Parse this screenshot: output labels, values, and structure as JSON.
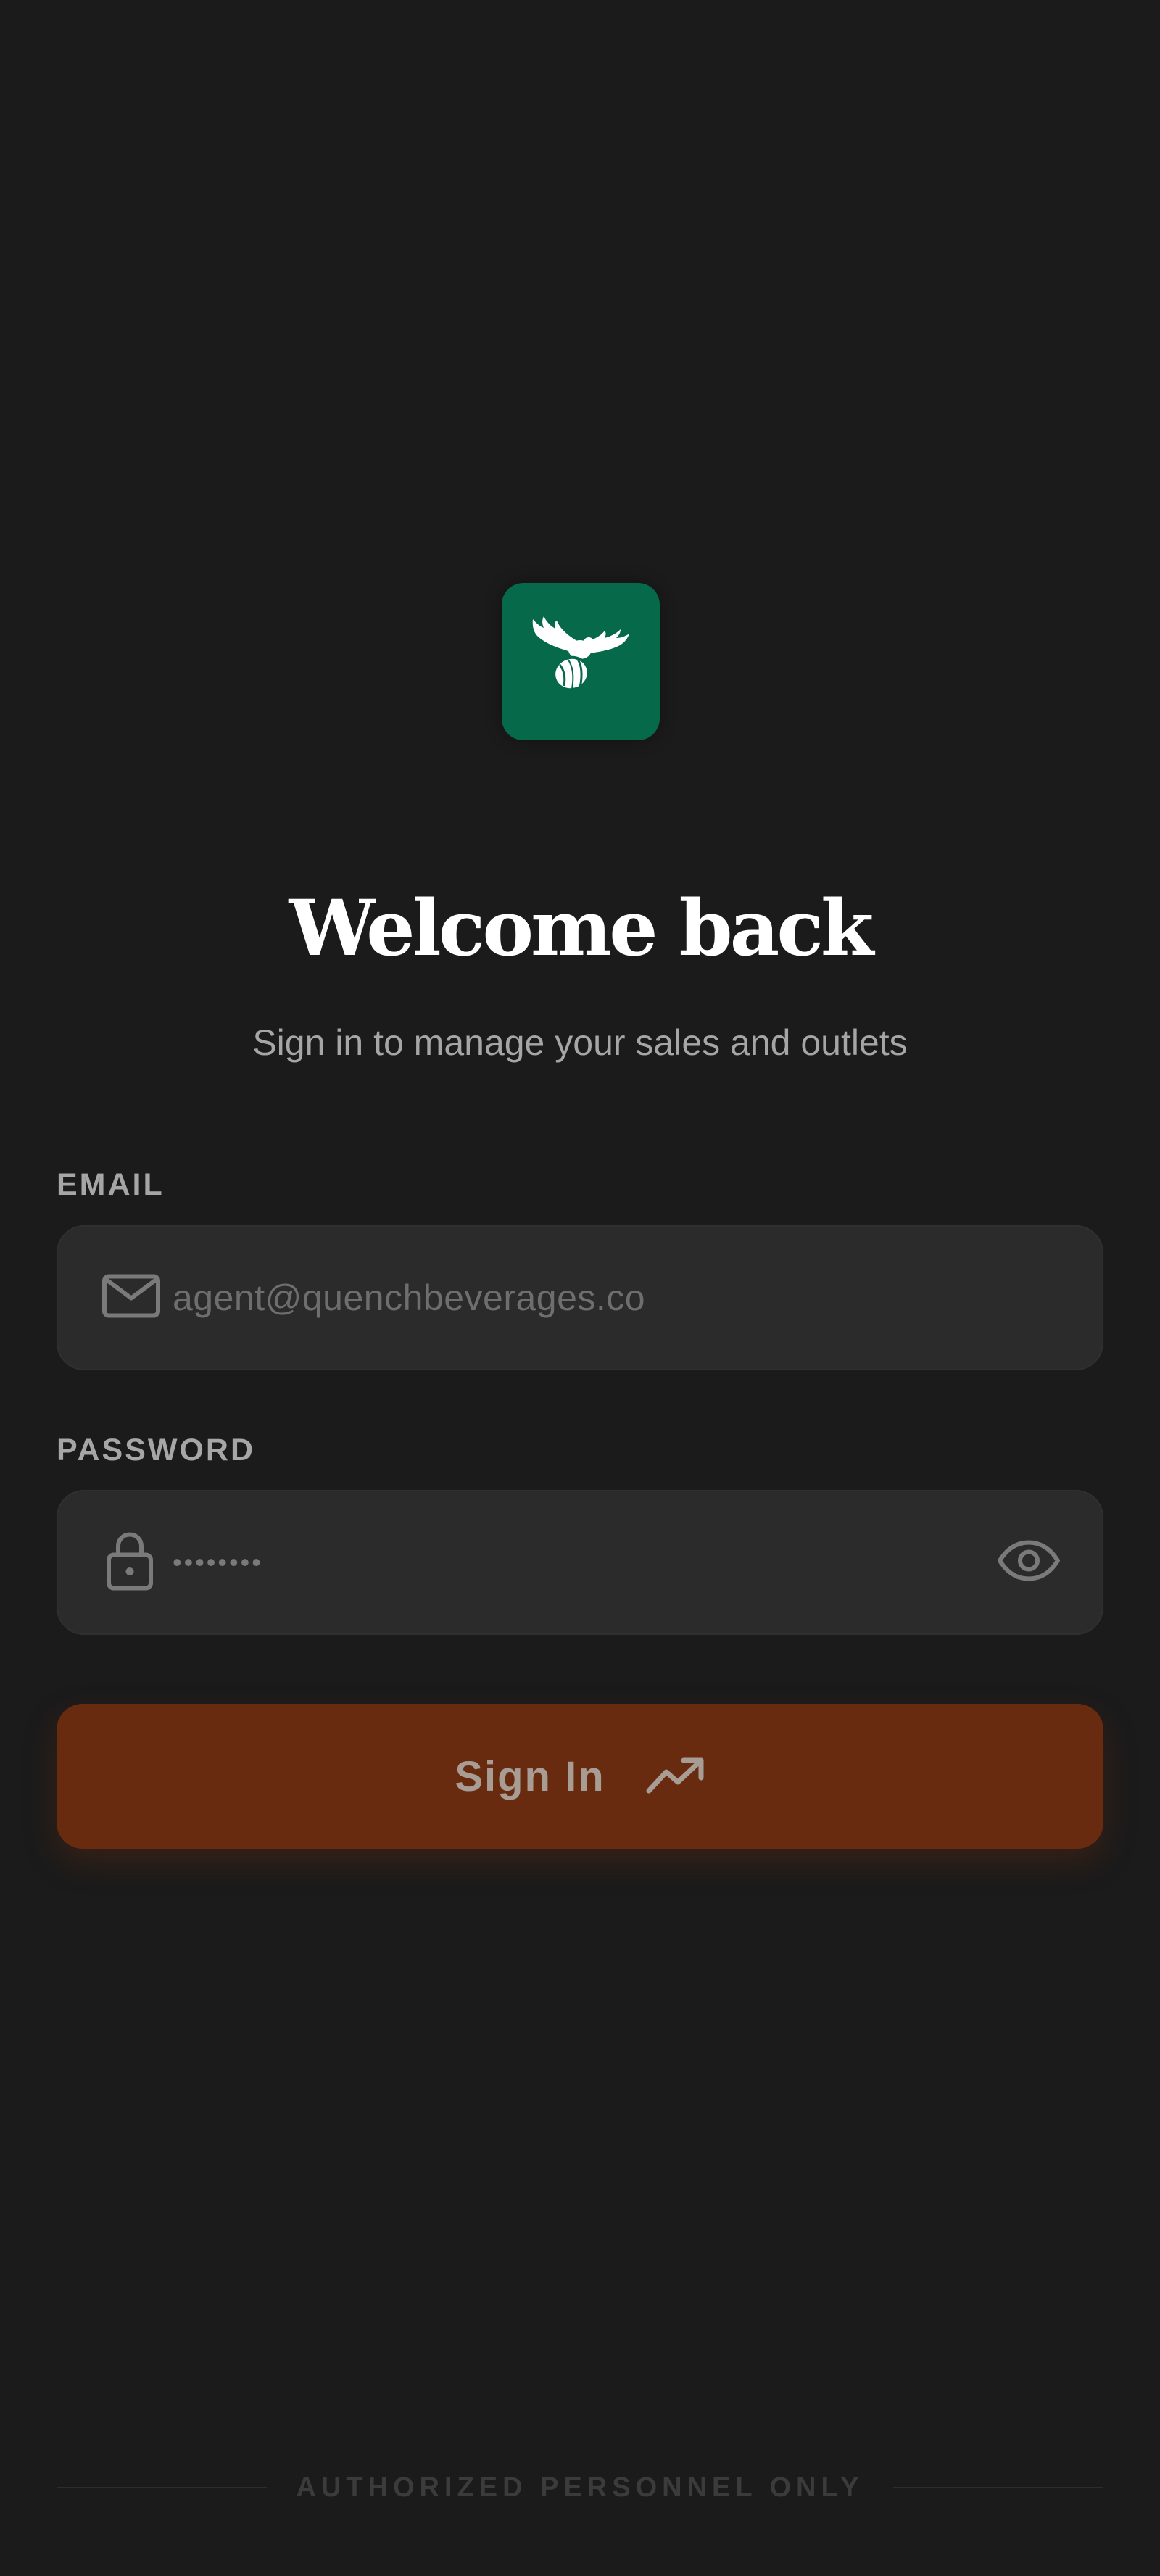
{
  "brand": {
    "logo_icon": "eagle-carrying-barrel-icon",
    "logo_bg_color": "#05694a"
  },
  "header": {
    "title": "Welcome back",
    "subtitle": "Sign in to manage your sales and outlets"
  },
  "form": {
    "email": {
      "label": "EMAIL",
      "placeholder": "agent@quenchbeverages.co",
      "icon": "mail-icon"
    },
    "password": {
      "label": "PASSWORD",
      "value_masked": "••••••••",
      "icon": "lock-icon",
      "toggle_icon": "eye-icon"
    },
    "submit": {
      "label": "Sign In",
      "icon": "trending-up-icon",
      "color": "#692b0f"
    }
  },
  "footer": {
    "text": "AUTHORIZED PERSONNEL ONLY"
  }
}
